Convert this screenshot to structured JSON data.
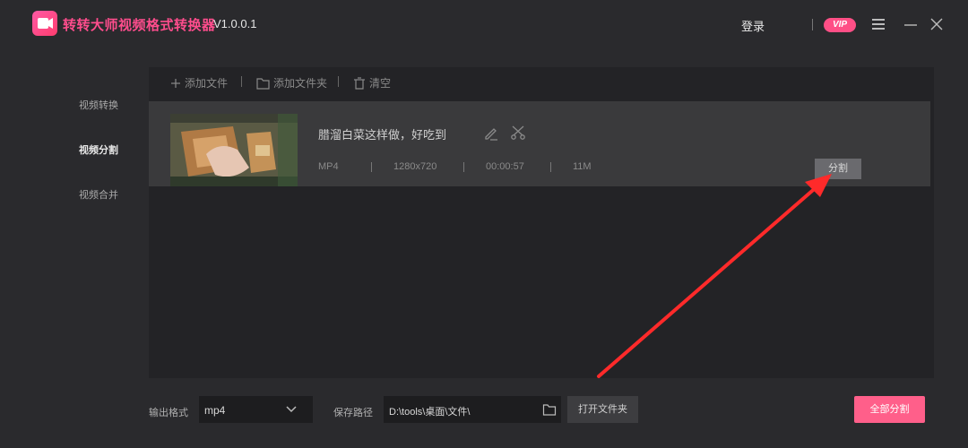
{
  "app": {
    "title": "转转大师视频格式转换器",
    "version": "V1.0.0.1",
    "login_label": "登录",
    "vip_label": "VIP",
    "accent_color": "#ff4d8d"
  },
  "sidebar": {
    "items": [
      {
        "label": "视频转换",
        "active": false
      },
      {
        "label": "视频分割",
        "active": true
      },
      {
        "label": "视频合并",
        "active": false
      }
    ]
  },
  "toolbar": {
    "add_file_label": "添加文件",
    "add_folder_label": "添加文件夹",
    "clear_label": "清空"
  },
  "file": {
    "name": "腊溜白菜这样做，好吃到",
    "format": "MP4",
    "resolution": "1280x720",
    "duration": "00:00:57",
    "size": "11M",
    "split_label": "分割"
  },
  "bottom": {
    "output_format_label": "输出格式",
    "output_format_value": "mp4",
    "save_path_label": "保存路径",
    "save_path_value": "D:\\tools\\桌面\\文件\\",
    "open_folder_label": "打开文件夹",
    "split_all_label": "全部分割"
  },
  "annotation": {
    "arrow_color": "#ff2a2a"
  }
}
